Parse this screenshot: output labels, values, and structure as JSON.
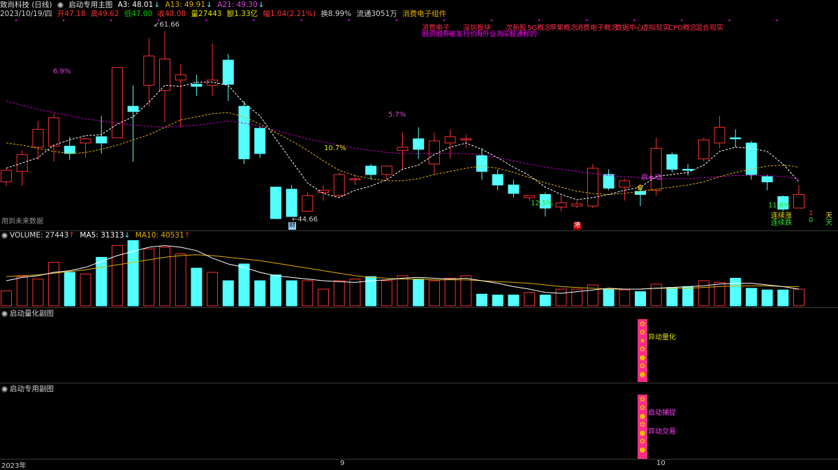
{
  "header": {
    "stock_name": "致尚科技 (日线)",
    "indicator_name": "启动专用主图",
    "a3_label": "A3: 48.01",
    "a13_label": "A13: 49.91",
    "a21_label": "A21: 49.30",
    "date": "2023/10/19/四",
    "open": "开47.18",
    "high": "高49.62",
    "low": "低47.00",
    "close": "收48.08",
    "volume": "量27443",
    "amount": "额1.33亿",
    "change": "幅1.04(2.21%)",
    "turnover": "换8.99%",
    "float": "流通3051万",
    "sector": "消费电子组件"
  },
  "concepts": {
    "row1_red": [
      "消费电子",
      "深圳板块",
      "次新股",
      "5G概念",
      "苹果概念",
      "消费电子概念",
      "数据中心",
      "虚拟现实",
      "CPO概念",
      "混合现实"
    ],
    "row2_magenta": [
      "融资融券",
      "破发行价",
      "海外业务",
      "深股通标的"
    ]
  },
  "main_chart": {
    "high_label": "61.66",
    "low_label": "44.66",
    "pct_labels": [
      "6.9%",
      "10.7%",
      "5.7%",
      "12.5%",
      "11.6%"
    ],
    "signal_label": "启★动",
    "watermark": "用到未来数据",
    "streak_up_label": "连续涨",
    "streak_up_value": "1",
    "streak_down_label": "连续跌",
    "streak_down_value": "0",
    "days_unit": "天",
    "event_marker_1": "财",
    "event_marker_2": "港"
  },
  "volume_panel": {
    "title_volume": "VOLUME: 27443",
    "title_ma5": "MA5: 31313",
    "title_ma10": "MA10: 40531"
  },
  "sub1": {
    "title": "启动量化副图",
    "signal": "异动量化"
  },
  "sub2": {
    "title": "启动专用副图",
    "signal1": "启动捕捉",
    "signal2": "异动交易"
  },
  "x_axis": {
    "labels": [
      "2023年",
      "9",
      "10"
    ]
  },
  "colors": {
    "up": "#ff3030",
    "down": "#54ffff",
    "ma5": "#ffffff",
    "ma10": "#e0b000",
    "ma21": "#c000c0",
    "bg": "#000000"
  },
  "chart_data": {
    "type": "candlestick",
    "y_range": [
      44,
      62.5
    ],
    "candles": [
      {
        "o": 47.3,
        "h": 48.6,
        "l": 46.9,
        "c": 48.4
      },
      {
        "o": 48.3,
        "h": 50.3,
        "l": 46.9,
        "c": 49.9
      },
      {
        "o": 50.6,
        "h": 53.1,
        "l": 49.4,
        "c": 52.3
      },
      {
        "o": 50.7,
        "h": 53.8,
        "l": 49.2,
        "c": 53.4
      },
      {
        "o": 50.7,
        "h": 51.6,
        "l": 49.4,
        "c": 50.0
      },
      {
        "o": 51.0,
        "h": 51.5,
        "l": 49.6,
        "c": 51.4
      },
      {
        "o": 51.6,
        "h": 53.6,
        "l": 50.0,
        "c": 51.0
      },
      {
        "o": 51.5,
        "h": 55.0,
        "l": 51.5,
        "c": 58.2
      },
      {
        "o": 54.5,
        "h": 56.5,
        "l": 49.2,
        "c": 54.0
      },
      {
        "o": 56.5,
        "h": 61.0,
        "l": 54.5,
        "c": 59.3
      },
      {
        "o": 56.0,
        "h": 61.66,
        "l": 53.0,
        "c": 59.0
      },
      {
        "o": 57.0,
        "h": 58.5,
        "l": 52.5,
        "c": 57.5
      },
      {
        "o": 56.6,
        "h": 57.5,
        "l": 55.5,
        "c": 56.4
      },
      {
        "o": 56.5,
        "h": 60.5,
        "l": 55.5,
        "c": 57.0
      },
      {
        "o": 58.9,
        "h": 59.5,
        "l": 55.0,
        "c": 56.6
      },
      {
        "o": 54.5,
        "h": 55.0,
        "l": 49.0,
        "c": 49.5
      },
      {
        "o": 52.4,
        "h": 52.6,
        "l": 49.6,
        "c": 50.0
      },
      {
        "o": 46.8,
        "h": 46.8,
        "l": 45.5,
        "c": 43.8
      },
      {
        "o": 46.6,
        "h": 47.0,
        "l": 44.1,
        "c": 44.0
      },
      {
        "o": 44.5,
        "h": 46.3,
        "l": 44.66,
        "c": 46.0
      },
      {
        "o": 46.3,
        "h": 47.0,
        "l": 45.5,
        "c": 46.5
      },
      {
        "o": 46.0,
        "h": 48.2,
        "l": 45.8,
        "c": 48.0
      },
      {
        "o": 47.6,
        "h": 48.0,
        "l": 47.0,
        "c": 47.6
      },
      {
        "o": 48.8,
        "h": 49.0,
        "l": 47.5,
        "c": 48.0
      },
      {
        "o": 48.0,
        "h": 48.6,
        "l": 47.5,
        "c": 48.8
      },
      {
        "o": 50.3,
        "h": 52.0,
        "l": 48.5,
        "c": 50.6
      },
      {
        "o": 51.4,
        "h": 52.5,
        "l": 49.5,
        "c": 50.4
      },
      {
        "o": 49.0,
        "h": 52.0,
        "l": 48.0,
        "c": 51.2
      },
      {
        "o": 51.0,
        "h": 52.3,
        "l": 49.5,
        "c": 51.6
      },
      {
        "o": 51.4,
        "h": 51.8,
        "l": 50.5,
        "c": 51.4
      },
      {
        "o": 49.8,
        "h": 50.5,
        "l": 47.5,
        "c": 48.3
      },
      {
        "o": 48.0,
        "h": 48.5,
        "l": 46.5,
        "c": 47.0
      },
      {
        "o": 47.0,
        "h": 47.5,
        "l": 45.8,
        "c": 46.2
      },
      {
        "o": 45.8,
        "h": 46.0,
        "l": 45.5,
        "c": 46.0
      },
      {
        "o": 46.1,
        "h": 46.3,
        "l": 44.0,
        "c": 44.8
      },
      {
        "o": 44.9,
        "h": 46.0,
        "l": 44.5,
        "c": 45.3
      },
      {
        "o": 45.0,
        "h": 45.5,
        "l": 44.8,
        "c": 45.2
      },
      {
        "o": 45.0,
        "h": 49.0,
        "l": 44.8,
        "c": 48.6
      },
      {
        "o": 48.0,
        "h": 48.5,
        "l": 46.5,
        "c": 46.7
      },
      {
        "o": 46.8,
        "h": 47.6,
        "l": 45.5,
        "c": 47.4
      },
      {
        "o": 46.4,
        "h": 46.8,
        "l": 45.0,
        "c": 46.1
      },
      {
        "o": 46.5,
        "h": 51.5,
        "l": 46.0,
        "c": 50.5
      },
      {
        "o": 49.9,
        "h": 50.1,
        "l": 48.2,
        "c": 48.5
      },
      {
        "o": 48.5,
        "h": 49.0,
        "l": 47.9,
        "c": 48.4
      },
      {
        "o": 49.5,
        "h": 51.5,
        "l": 49.2,
        "c": 51.3
      },
      {
        "o": 51.0,
        "h": 53.6,
        "l": 50.5,
        "c": 52.5
      },
      {
        "o": 51.5,
        "h": 52.3,
        "l": 50.6,
        "c": 51.4
      },
      {
        "o": 51.0,
        "h": 51.2,
        "l": 47.5,
        "c": 48.0
      },
      {
        "o": 47.8,
        "h": 48.0,
        "l": 46.5,
        "c": 47.3
      },
      {
        "o": 45.9,
        "h": 46.0,
        "l": 44.5,
        "c": 44.7
      },
      {
        "o": 44.8,
        "h": 47.0,
        "l": 44.8,
        "c": 46.1
      }
    ],
    "ma5": [
      48.6,
      49.1,
      49.6,
      50.8,
      51.3,
      51.7,
      51.8,
      52.8,
      53.5,
      54.9,
      56.5,
      56.4,
      56.8,
      56.8,
      56.5,
      54.8,
      53.6,
      51.4,
      49.3,
      47.2,
      46.2,
      45.8,
      46.5,
      46.9,
      47.5,
      48.5,
      48.9,
      49.9,
      50.6,
      51.0,
      50.4,
      49.6,
      48.7,
      47.9,
      46.8,
      46.1,
      45.6,
      45.8,
      46.1,
      46.5,
      46.8,
      47.8,
      48.0,
      48.2,
      48.9,
      50.2,
      50.6,
      50.5,
      50.2,
      49.0,
      47.3
    ],
    "ma10": [
      51.0,
      50.8,
      50.5,
      50.2,
      50.0,
      50.1,
      50.4,
      50.8,
      51.3,
      51.8,
      52.5,
      53.2,
      53.5,
      53.8,
      53.9,
      53.5,
      52.8,
      52.0,
      51.2,
      50.3,
      49.3,
      48.4,
      47.9,
      47.6,
      47.4,
      47.4,
      47.6,
      48.0,
      48.3,
      48.6,
      48.8,
      48.6,
      48.2,
      47.7,
      47.2,
      46.8,
      46.4,
      46.2,
      46.1,
      46.2,
      46.4,
      46.6,
      46.8,
      47.0,
      47.3,
      47.8,
      48.2,
      48.5,
      48.8,
      48.9,
      48.7
    ],
    "ma21": [
      55.0,
      54.6,
      54.2,
      53.9,
      53.6,
      53.3,
      53.1,
      52.9,
      52.7,
      52.6,
      52.5,
      52.6,
      52.7,
      52.9,
      53.1,
      52.9,
      52.6,
      52.2,
      51.8,
      51.4,
      51.1,
      50.8,
      50.5,
      50.3,
      50.1,
      50.0,
      50.0,
      50.0,
      50.0,
      50.0,
      49.9,
      49.6,
      49.3,
      49.0,
      48.7,
      48.5,
      48.3,
      48.1,
      47.9,
      47.8,
      47.7,
      47.6,
      47.6,
      47.6,
      47.7,
      47.8,
      47.9,
      47.9,
      47.9,
      47.8,
      47.6
    ],
    "volume": [
      18,
      35,
      32,
      52,
      40,
      38,
      58,
      72,
      78,
      68,
      70,
      62,
      45,
      40,
      30,
      50,
      30,
      37,
      30,
      30,
      20,
      30,
      32,
      35,
      30,
      36,
      32,
      30,
      33,
      36,
      14,
      13,
      13,
      16,
      13,
      20,
      20,
      25,
      20,
      19,
      17,
      26,
      22,
      23,
      30,
      28,
      33,
      21,
      19,
      19,
      20
    ],
    "volume_ma5": [
      30,
      34,
      36,
      40,
      42,
      46,
      53,
      60,
      65,
      70,
      72,
      70,
      66,
      57,
      50,
      46,
      40,
      36,
      34,
      32,
      30,
      29,
      28,
      30,
      31,
      33,
      34,
      33,
      32,
      33,
      30,
      27,
      23,
      20,
      16,
      15,
      17,
      19,
      21,
      20,
      20,
      21,
      22,
      23,
      24,
      26,
      27,
      27,
      25,
      23,
      20
    ],
    "volume_ma10": [
      35,
      36,
      37,
      39,
      41,
      43,
      46,
      49,
      52,
      55,
      58,
      60,
      61,
      60,
      58,
      56,
      54,
      51,
      48,
      45,
      42,
      39,
      36,
      34,
      33,
      32,
      32,
      31,
      31,
      31,
      30,
      29,
      28,
      27,
      25,
      23,
      22,
      21,
      20,
      20,
      20,
      21,
      21,
      21,
      22,
      23,
      24,
      24,
      24,
      23,
      23
    ]
  }
}
